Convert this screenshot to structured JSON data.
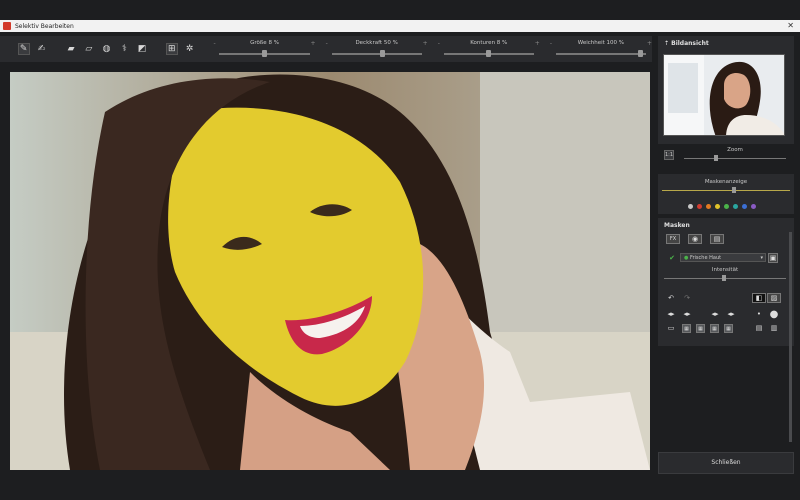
{
  "window": {
    "title": "Selektiv Bearbeiten"
  },
  "toolbar": {
    "tools": [
      {
        "name": "brush-icon",
        "glyph": "✎"
      },
      {
        "name": "smart-brush-icon",
        "glyph": "✍"
      },
      {
        "name": "eraser-icon",
        "glyph": "▰"
      },
      {
        "name": "smart-eraser-icon",
        "glyph": "▱"
      },
      {
        "name": "fill-icon",
        "glyph": "◍"
      },
      {
        "name": "magic-wand-icon",
        "glyph": "⚕"
      },
      {
        "name": "gradient-icon",
        "glyph": "◩"
      },
      {
        "name": "auto-mask-icon",
        "glyph": "⊞"
      },
      {
        "name": "auto-select-icon",
        "glyph": "✲"
      }
    ],
    "sliders": [
      {
        "id": "size",
        "label": "Größe 8     %",
        "level_pct": 48
      },
      {
        "id": "strength",
        "label": "Deckkraft 50    %",
        "level_pct": 55
      },
      {
        "id": "contours",
        "label": "Konturen 8    %",
        "level_pct": 48
      },
      {
        "id": "softness",
        "label": "Weichheit 100    %",
        "level_pct": 92
      }
    ]
  },
  "panel": {
    "preview_title": "Bildansicht",
    "zoom_label": "Zoom",
    "mask_display_label": "Maskenanzeige",
    "mask_colors": [
      "#c8c8c8",
      "#d13b30",
      "#e27a22",
      "#e0c32a",
      "#4bb34a",
      "#2aa6a0",
      "#3b6fd4",
      "#8a5bc4"
    ],
    "masks_title": "Masken",
    "mask_selected": "Frische Haut",
    "intensity_label": "Intensität",
    "apply_label": "Schließen"
  }
}
